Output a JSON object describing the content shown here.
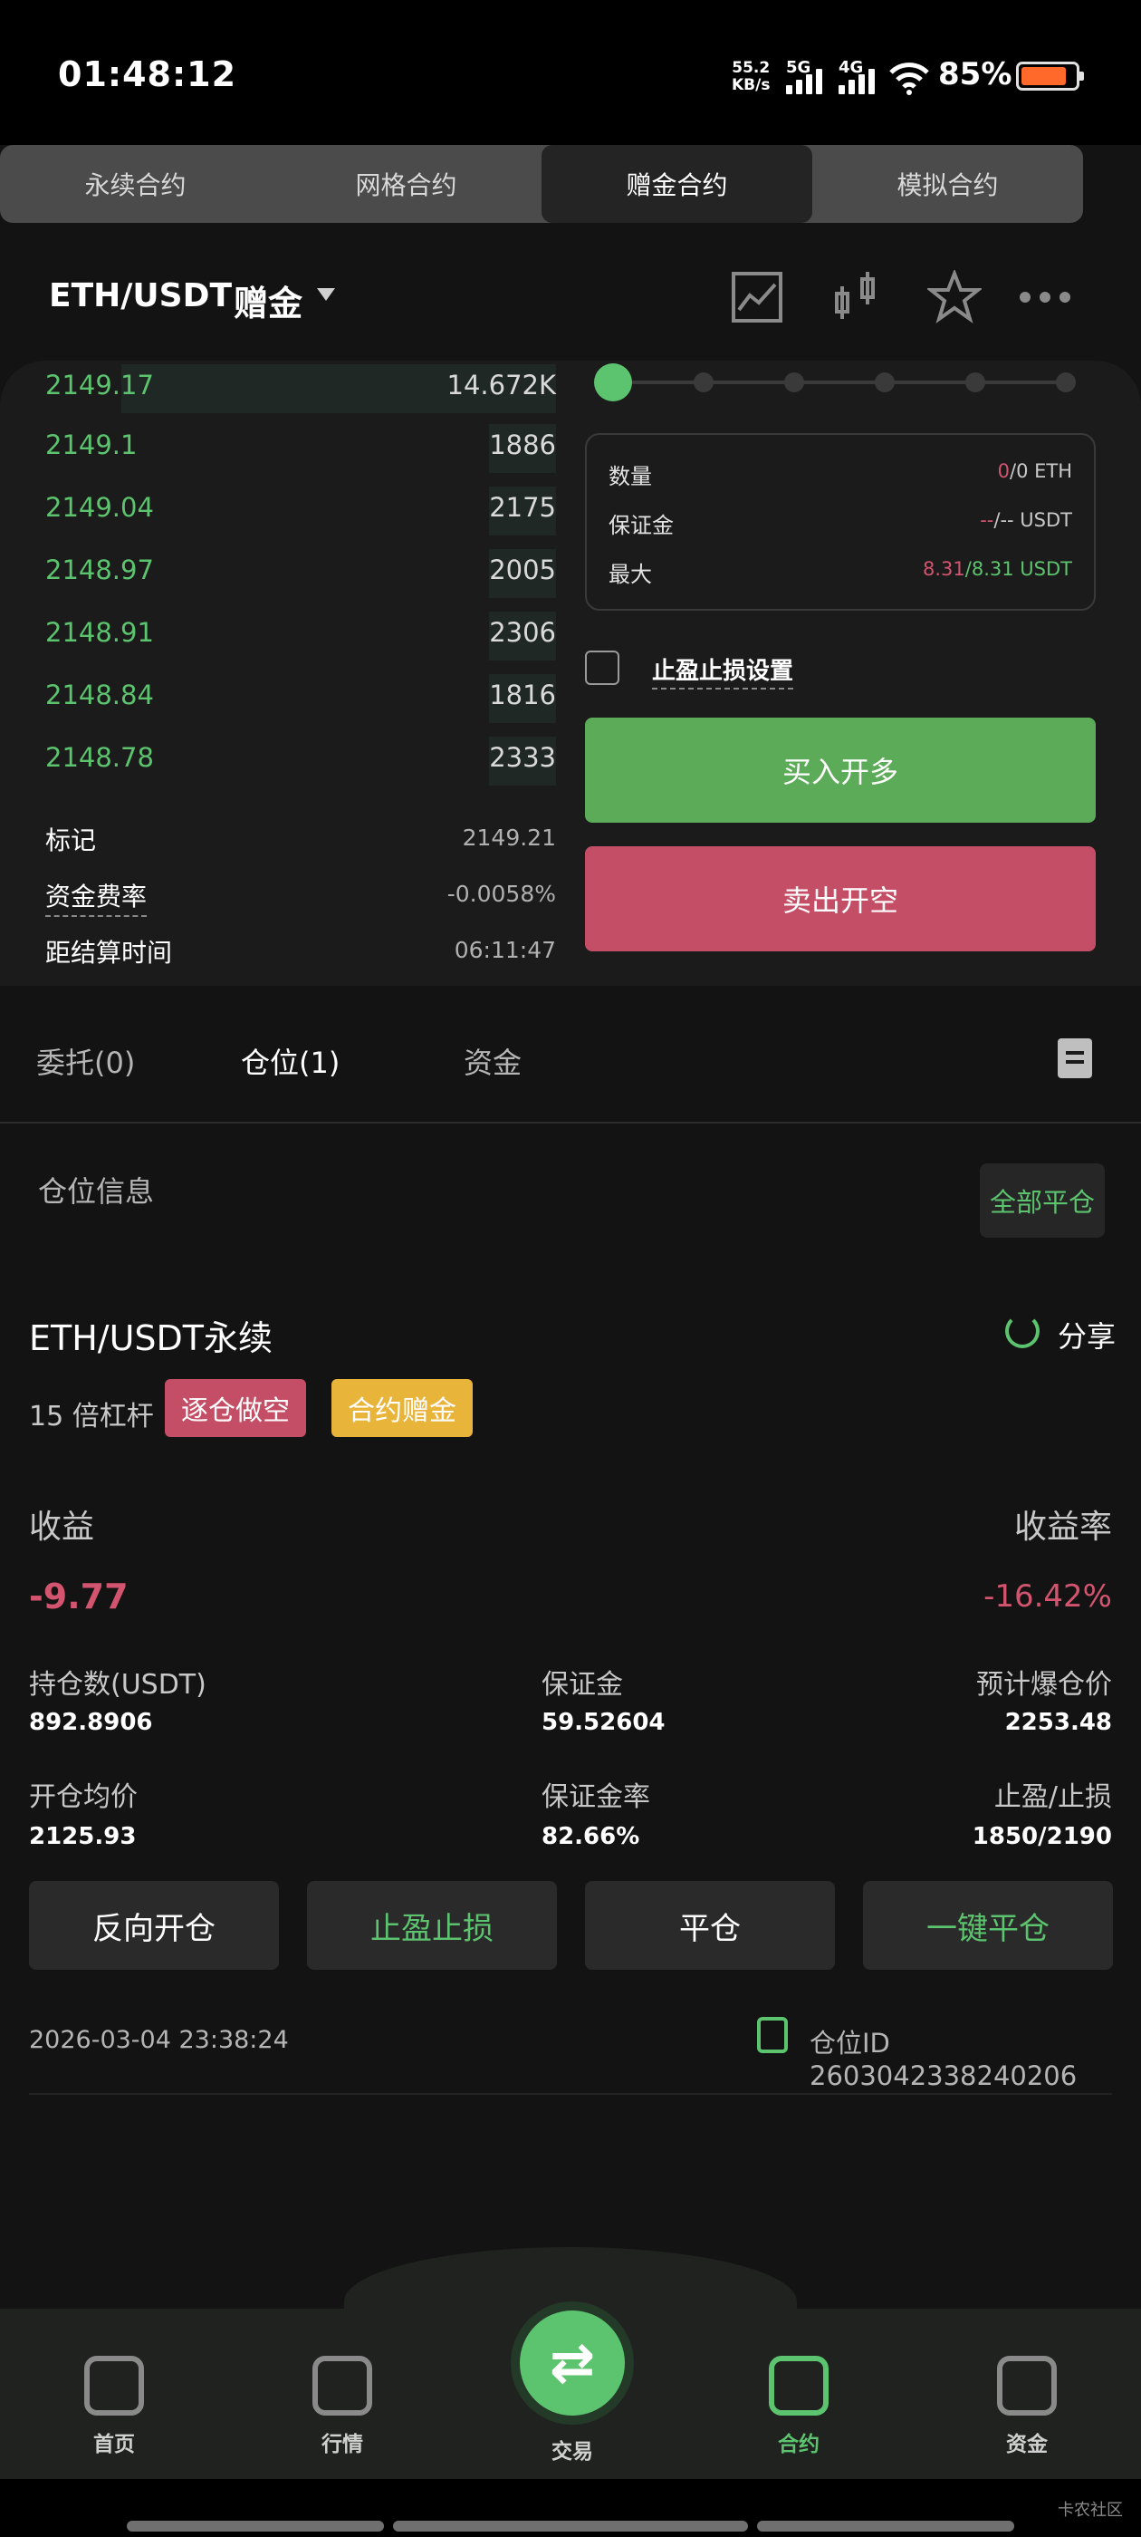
{
  "status_bar": {
    "time": "01:48:12",
    "net_speed_value": "55.2",
    "net_speed_unit": "KB/s",
    "sig1": "5G",
    "sig2": "4G",
    "battery": "85%"
  },
  "top_tabs": [
    {
      "label": "永续合约"
    },
    {
      "label": "网格合约"
    },
    {
      "label": "赠金合约"
    },
    {
      "label": "模拟合约"
    }
  ],
  "pair": {
    "symbol": "ETH/USDT",
    "mode": "赠金"
  },
  "icons": {
    "chart": "line-chart-icon",
    "kline": "candlestick-icon",
    "fav": "star-icon",
    "more": "more-icon"
  },
  "orderbook": [
    {
      "price": "2149.17",
      "qty": "14.672K"
    },
    {
      "price": "2149.1",
      "qty": "1886"
    },
    {
      "price": "2149.04",
      "qty": "2175"
    },
    {
      "price": "2148.97",
      "qty": "2005"
    },
    {
      "price": "2148.91",
      "qty": "2306"
    },
    {
      "price": "2148.84",
      "qty": "1816"
    },
    {
      "price": "2148.78",
      "qty": "2333"
    }
  ],
  "market": {
    "mark_label": "标记",
    "mark_value": "2149.21",
    "funding_label": "资金费率",
    "funding_value": "-0.0058%",
    "settle_label": "距结算时间",
    "settle_value": "06:11:47"
  },
  "order_form": {
    "qty_label": "数量",
    "qty_a": "0",
    "qty_b": "/0 ETH",
    "margin_label": "保证金",
    "margin_a": "--",
    "margin_b": "/-- USDT",
    "max_label": "最大",
    "max_a": "8.31",
    "max_b": "/8.31 USDT",
    "tpsl_label": "止盈止损设置",
    "buy_label": "买入开多",
    "sell_label": "卖出开空"
  },
  "sub_tabs": {
    "orders": "委托(0)",
    "positions": "仓位(1)",
    "funds": "资金"
  },
  "position_section": {
    "title": "仓位信息",
    "close_all": "全部平仓"
  },
  "position": {
    "symbol": "ETH/USDT永续",
    "share": "分享",
    "leverage": "15 倍杠杆",
    "tag_side": "逐仓做空",
    "tag_bonus": "合约赠金",
    "pnl_label": "收益",
    "pnl_value": "-9.77",
    "roe_label": "收益率",
    "roe_value": "-16.42%",
    "hold_label": "持仓数(USDT)",
    "hold_value": "892.8906",
    "margin_label": "保证金",
    "margin_value": "59.52604",
    "liq_label": "预计爆仓价",
    "liq_value": "2253.48",
    "entry_label": "开仓均价",
    "entry_value": "2125.93",
    "mratio_label": "保证金率",
    "mratio_value": "82.66%",
    "tpsl_label": "止盈/止损",
    "tpsl_value": "1850/2190",
    "btn_reverse": "反向开仓",
    "btn_tpsl": "止盈止损",
    "btn_close": "平仓",
    "btn_flash": "一键平仓",
    "time": "2026-03-04 23:38:24",
    "id_label": "仓位ID 2603042338240206"
  },
  "bottom_nav": {
    "home": "首页",
    "market": "行情",
    "trade": "交易",
    "contract": "合约",
    "assets": "资金"
  },
  "watermark": "卡农社区",
  "colors": {
    "green": "#5cc36e",
    "red": "#d3546f",
    "buy": "#5cab58",
    "sell": "#c34e65",
    "bonus_tag": "#e8b43a"
  }
}
